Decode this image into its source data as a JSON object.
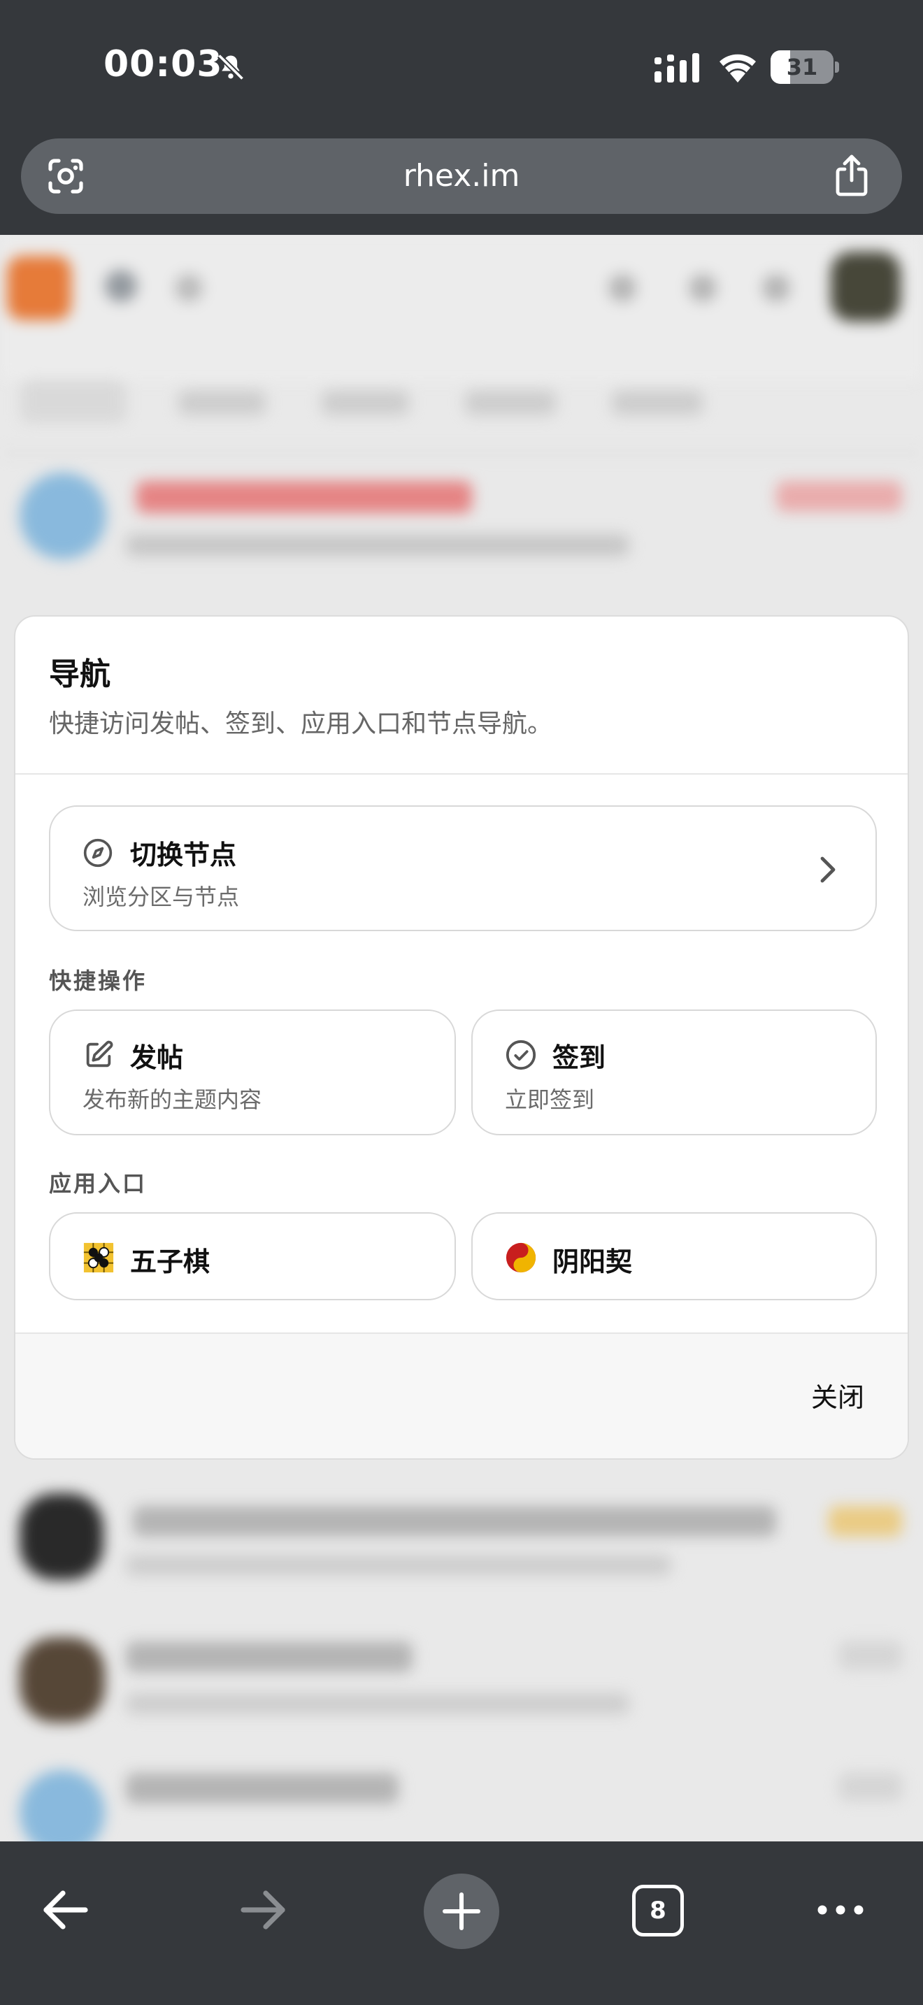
{
  "status_bar": {
    "time": "00:03",
    "battery": "31",
    "battery_level": 0.31
  },
  "browser": {
    "url": "rhex.im",
    "tab_count": "8"
  },
  "modal": {
    "title": "导航",
    "subtitle": "快捷访问发帖、签到、应用入口和节点导航。",
    "switch_node": {
      "title": "切换节点",
      "subtitle": "浏览分区与节点"
    },
    "quick_section": "快捷操作",
    "quick_actions": [
      {
        "title": "发帖",
        "subtitle": "发布新的主题内容",
        "icon": "edit-icon"
      },
      {
        "title": "签到",
        "subtitle": "立即签到",
        "icon": "check-circle-icon"
      }
    ],
    "apps_section": "应用入口",
    "apps": [
      {
        "title": "五子棋",
        "icon": "gomoku-icon"
      },
      {
        "title": "阴阳契",
        "icon": "yin-yang-icon"
      }
    ],
    "close_label": "关闭"
  },
  "colors": {
    "chrome_bg": "#35383c",
    "url_bar": "#5f6368",
    "brand_orange": "#f0803c"
  }
}
